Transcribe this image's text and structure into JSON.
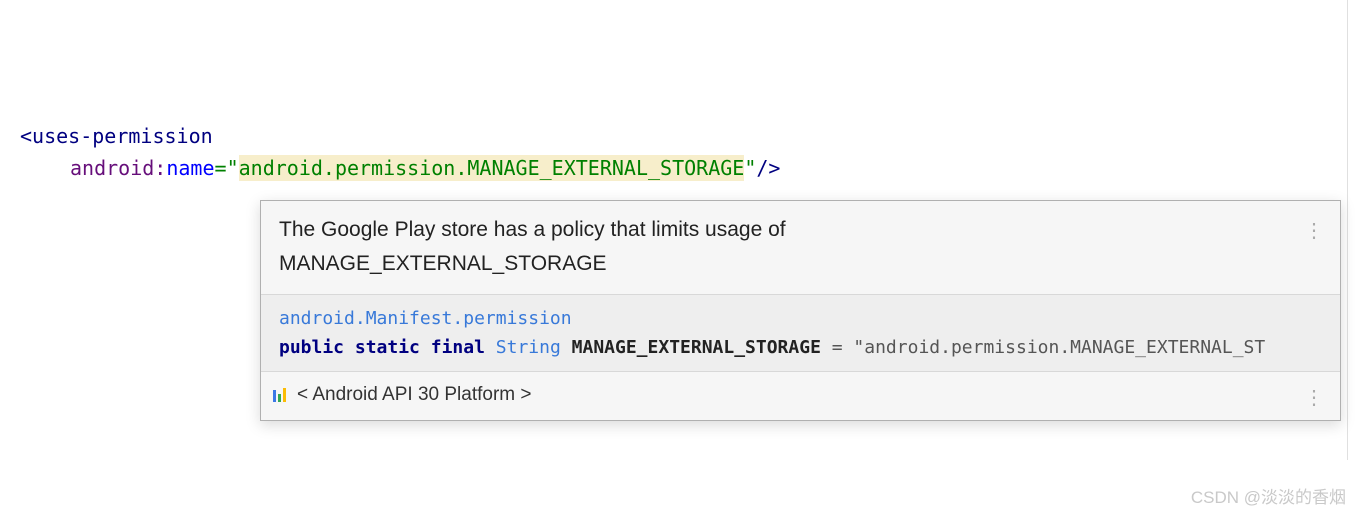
{
  "code": {
    "tag_open": "<",
    "tag_name": "uses-permission",
    "attr_prefix": "android",
    "attr_colon": ":",
    "attr_name": "name",
    "eq": "=",
    "quote": "\"",
    "attr_value": "android.permission.MANAGE_EXTERNAL_STORAGE",
    "self_close": "/>"
  },
  "tooltip": {
    "header_line1": "The Google Play store has a policy that limits usage of",
    "header_line2": "MANAGE_EXTERNAL_STORAGE",
    "doc_link": "android.Manifest.permission",
    "decl_kw1": "public",
    "decl_kw2": "static",
    "decl_kw3": "final",
    "decl_type": "String",
    "decl_name": "MANAGE_EXTERNAL_STORAGE",
    "decl_eq": " = ",
    "decl_value": "\"android.permission.MANAGE_EXTERNAL_ST",
    "footer_text": "< Android API 30 Platform >"
  },
  "watermark": "CSDN @淡淡的香烟"
}
